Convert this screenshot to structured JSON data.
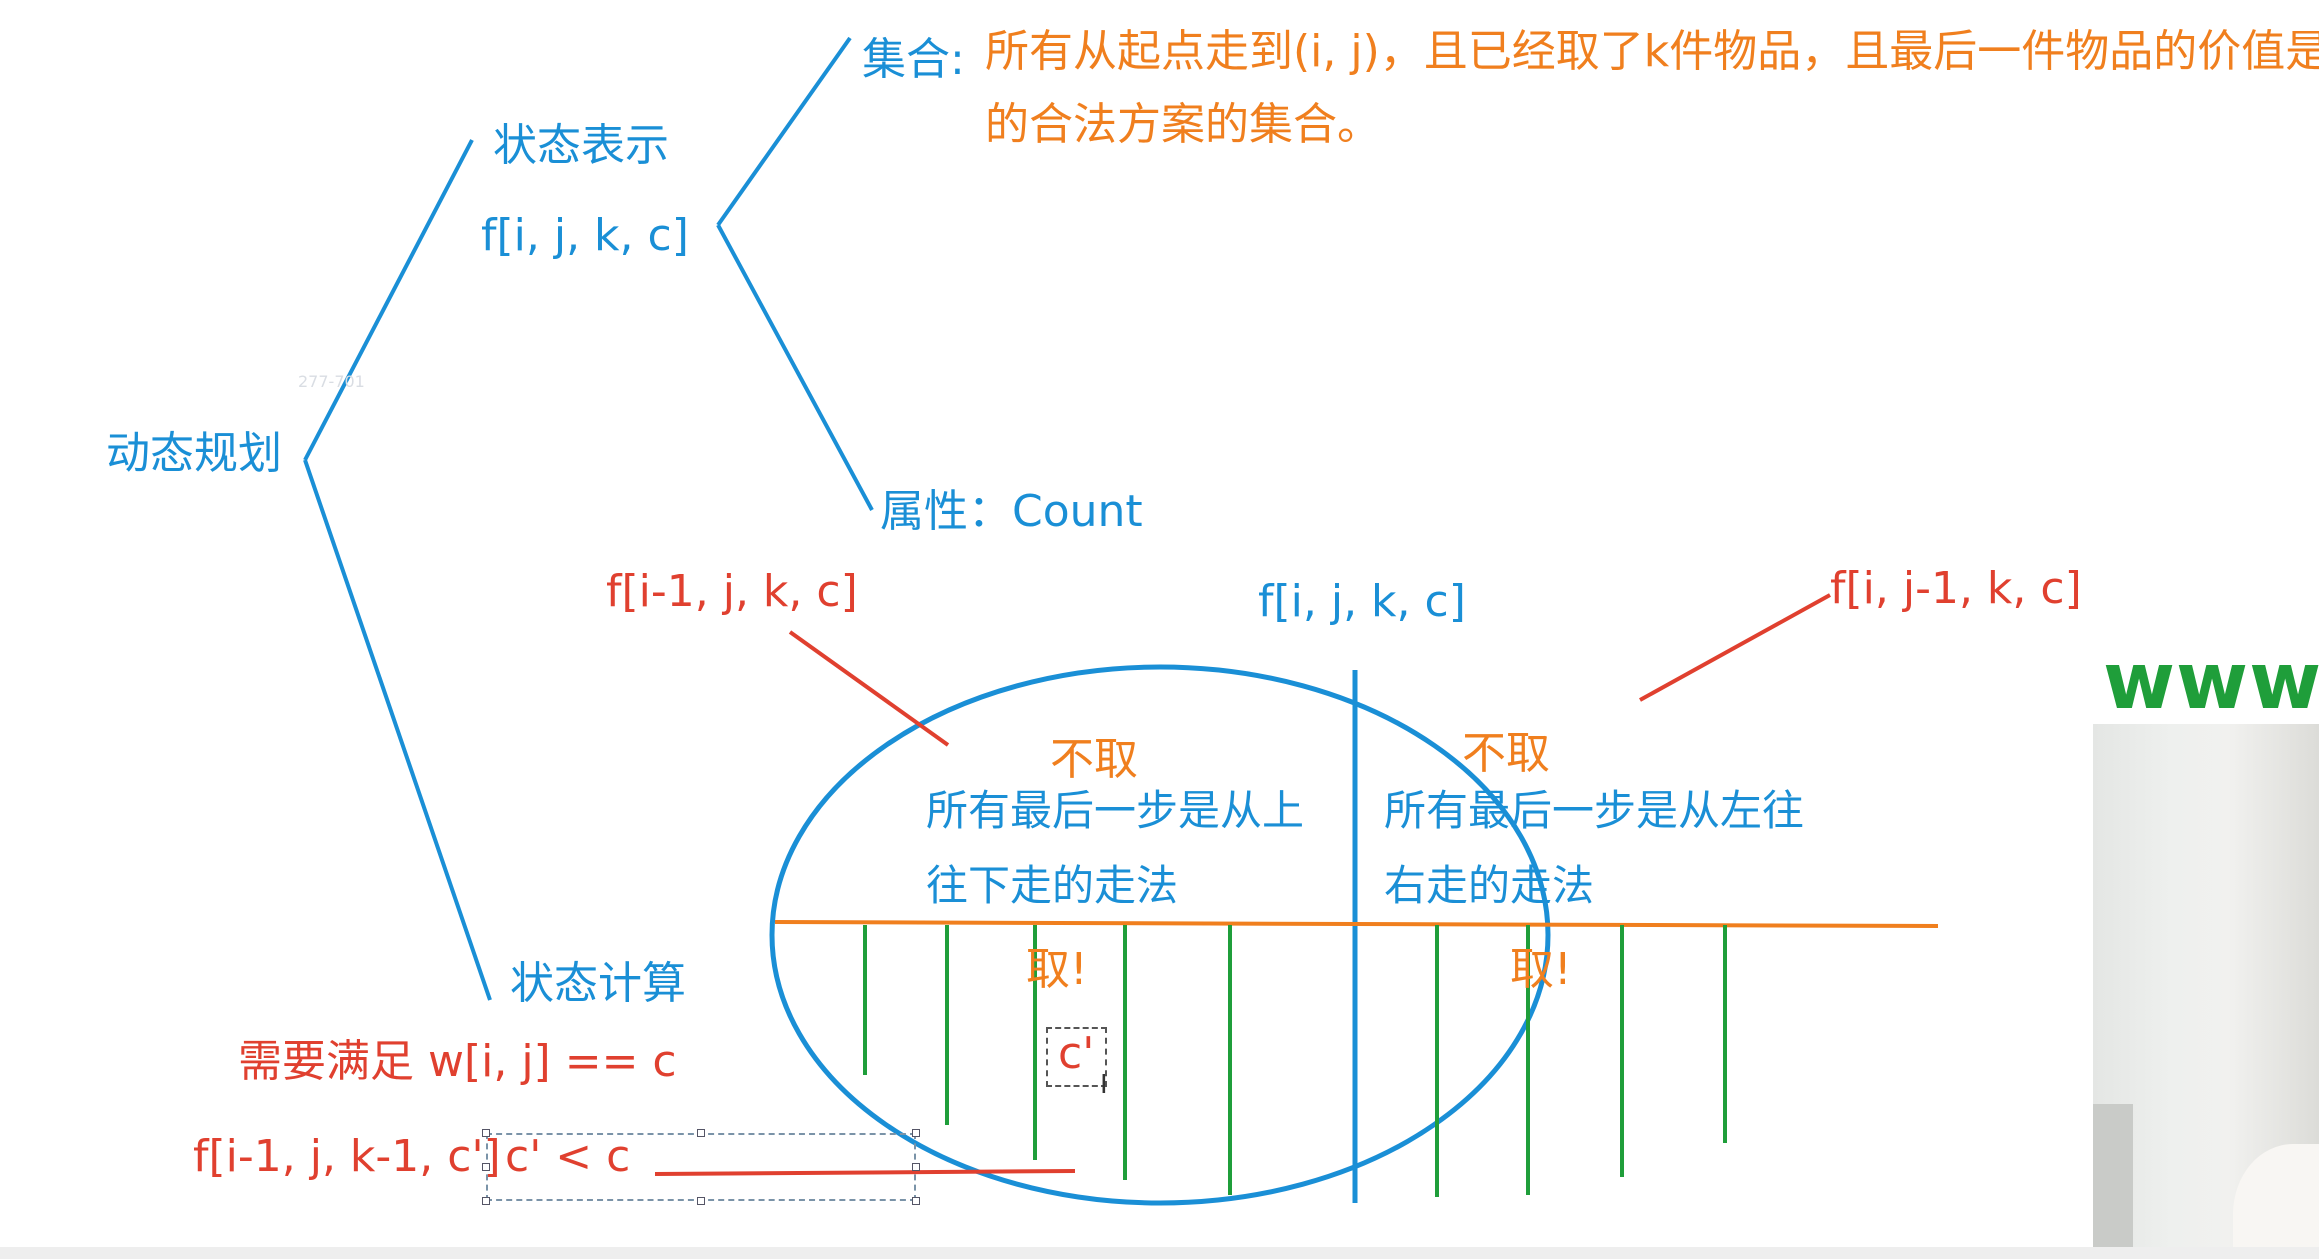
{
  "tree": {
    "root": "动态规划",
    "state_repr": {
      "label": "状态表示",
      "formula": "f[i, j, k, c]"
    },
    "set": {
      "label": "集合:",
      "text_line1": "所有从起点走到(i, j)，且已经取了k件物品，且最后一件物品的价值是C",
      "text_line2": "的合法方案的集合。"
    },
    "attribute": "属性：Count",
    "state_calc": "状态计算"
  },
  "ellipse": {
    "center_label": "f[i, j, k, c]",
    "left_ref": "f[i-1, j, k, c]",
    "right_ref": "f[i, j-1, k, c]",
    "left_top": {
      "title": "不取",
      "line1": "所有最后一步是从上",
      "line2": "往下走的走法"
    },
    "right_top": {
      "title": "不取",
      "line1": "所有最后一步是从左往",
      "line2": "右走的走法"
    },
    "left_bottom_title": "取!",
    "right_bottom_title": "取!",
    "c_prime": "c'"
  },
  "conditions": {
    "requirement": "需要满足 w[i, j] == c",
    "recurrence": "f[i-1, j, k-1, c']",
    "constraint": "c' < c"
  },
  "tiny_text": "277-701",
  "watermark": "www.a",
  "colors": {
    "blue": "#1a8fd6",
    "orange": "#f07f1e",
    "red": "#e0402f",
    "green": "#1f9e3a"
  }
}
